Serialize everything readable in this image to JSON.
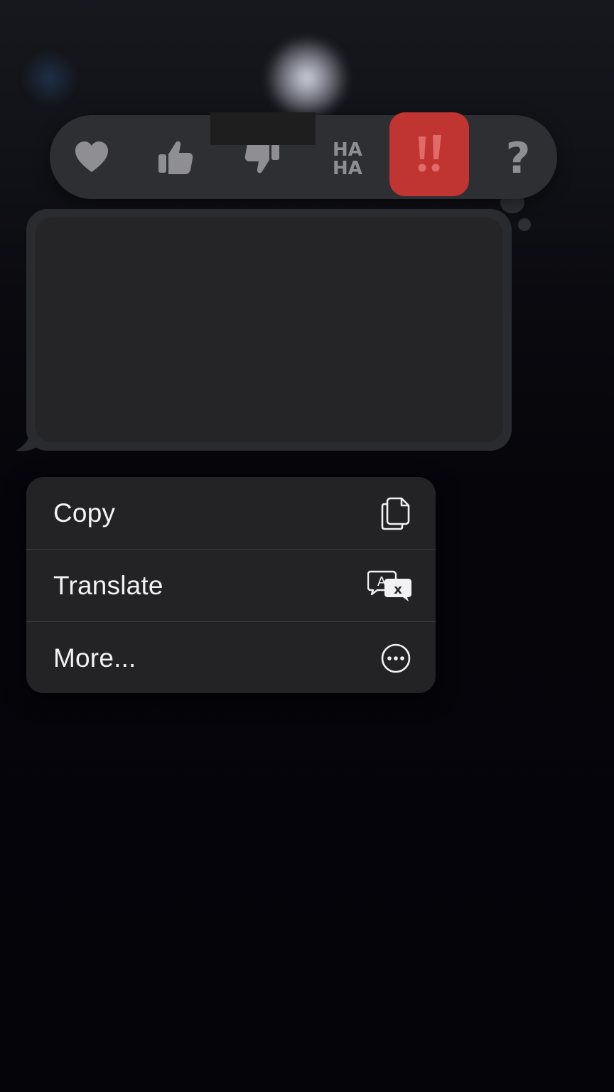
{
  "tapback": {
    "reactions": [
      {
        "icon": "heart-icon",
        "selected": false
      },
      {
        "icon": "thumbs-up-icon",
        "selected": false
      },
      {
        "icon": "thumbs-down-icon",
        "selected": false
      },
      {
        "icon": "haha-icon",
        "label_line1": "HA",
        "label_line2": "HA",
        "selected": false
      },
      {
        "icon": "exclamation-icon",
        "selected": true
      },
      {
        "icon": "question-icon",
        "label": "?",
        "selected": false
      }
    ],
    "selected_color": "#c03432",
    "icon_color": "#8e8e93"
  },
  "context_menu": {
    "items": [
      {
        "label": "Copy",
        "icon": "copy-icon"
      },
      {
        "label": "Translate",
        "icon": "translate-icon"
      },
      {
        "label": "More...",
        "icon": "more-icon"
      }
    ]
  }
}
